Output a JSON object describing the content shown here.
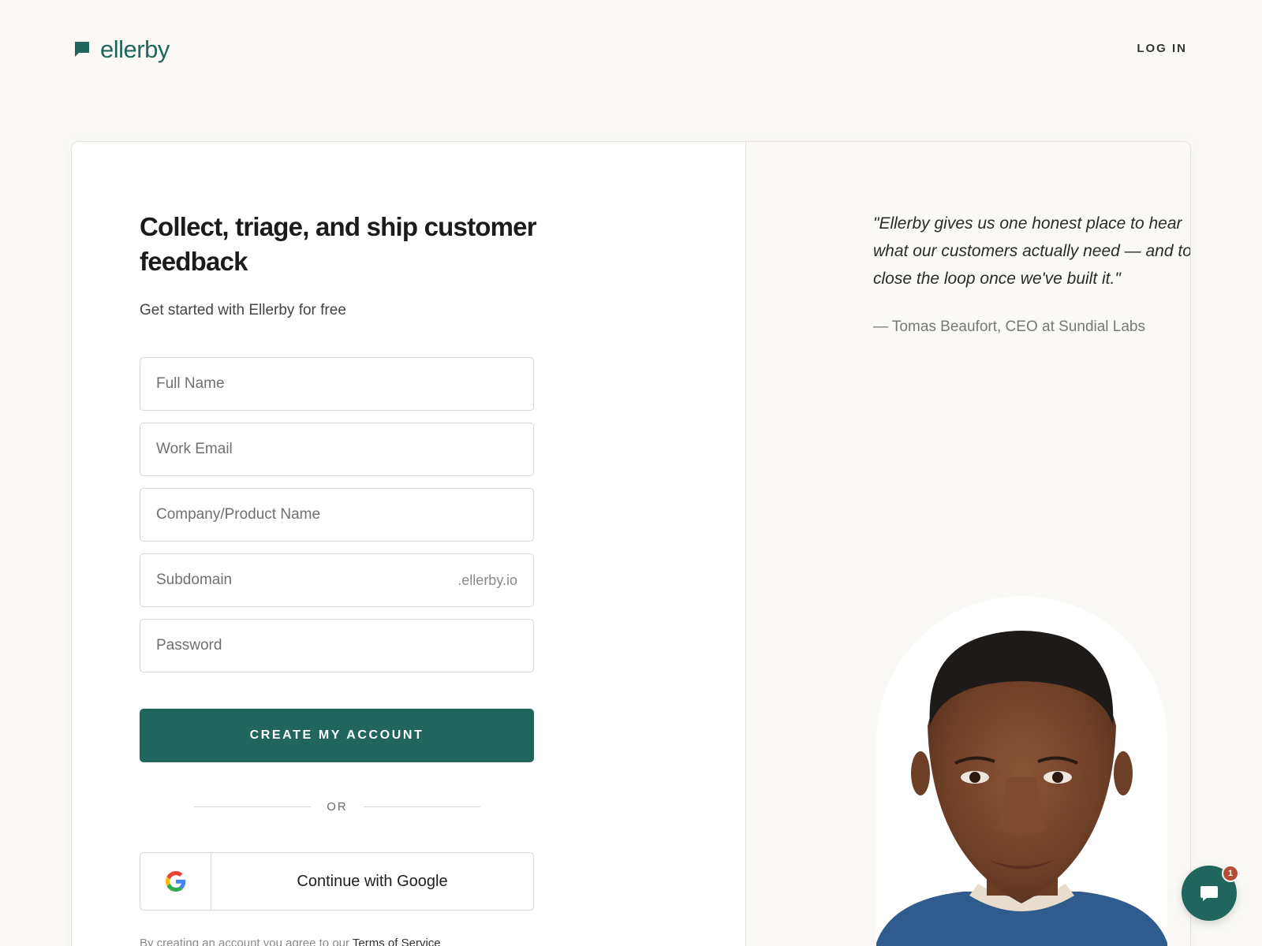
{
  "brand": {
    "name": "ellerby",
    "color": "#21665c",
    "icon": "chat-flag-icon"
  },
  "nav": {
    "login_label": "LOG IN"
  },
  "form": {
    "headline": "Collect, triage, and ship customer feedback",
    "subhead": "Get started with Ellerby for free",
    "fields": {
      "full_name": {
        "placeholder": "Full Name",
        "value": ""
      },
      "work_email": {
        "placeholder": "Work Email",
        "value": ""
      },
      "company": {
        "placeholder": "Company/Product Name",
        "value": ""
      },
      "subdomain": {
        "placeholder": "Subdomain",
        "value": "",
        "suffix": ".ellerby.io"
      },
      "password": {
        "placeholder": "Password",
        "value": ""
      }
    },
    "submit_label": "CREATE MY ACCOUNT",
    "divider_label": "OR",
    "google_label": "Continue with Google",
    "terms_prefix": "By creating an account you agree to our",
    "terms_link": "Terms of Service"
  },
  "testimonial": {
    "quote": "\"Ellerby gives us one honest place to hear what our customers actually need — and to close the loop once we've built it.\"",
    "attribution": "— Tomas Beaufort, CEO at Sundial Labs"
  },
  "chat": {
    "icon": "chat-bubble-icon",
    "unread_count": "1",
    "badge_color": "#b64e36"
  }
}
